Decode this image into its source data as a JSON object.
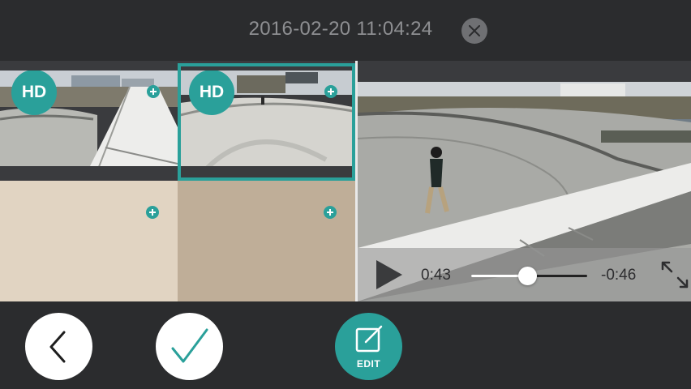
{
  "header": {
    "title": "2016-02-20 11:04:24",
    "close_icon": "close-icon"
  },
  "clips": [
    {
      "badge": "HD",
      "add_icon": "plus-icon",
      "selected": false
    },
    {
      "badge": "HD",
      "add_icon": "plus-icon",
      "selected": true
    }
  ],
  "empty_slots": [
    {
      "add_icon": "plus-icon",
      "color": "#e1d4c2"
    },
    {
      "add_icon": "plus-icon",
      "color": "#bfae98"
    }
  ],
  "player": {
    "play_icon": "play-icon",
    "current_time": "0:43",
    "remaining_time": "-0:46",
    "progress": 0.48,
    "expand_icon": "expand-icon"
  },
  "toolbar": {
    "back_icon": "chevron-left-icon",
    "confirm_icon": "checkmark-icon",
    "edit_icon": "edit-icon",
    "edit_label": "EDIT"
  },
  "colors": {
    "accent": "#2aa09a",
    "background": "#2b2c2e"
  }
}
